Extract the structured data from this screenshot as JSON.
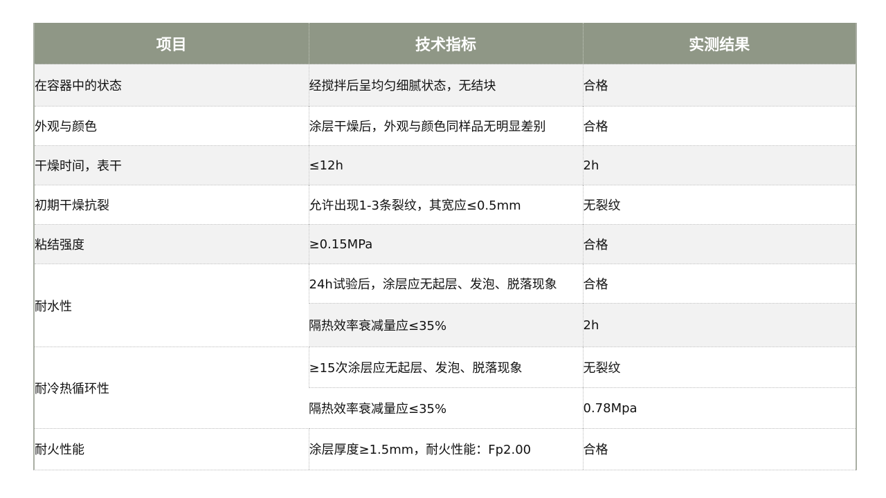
{
  "table": {
    "headers": [
      "项目",
      "技术指标",
      "实测结果"
    ],
    "rows": [
      {
        "item": "在容器中的状态",
        "spec": "经搅拌后呈均匀细腻状态，无结块",
        "result": "合格"
      },
      {
        "item": "外观与颜色",
        "spec": "涂层干燥后，外观与颜色同样品无明显差别",
        "result": "合格"
      },
      {
        "item": "干燥时间，表干",
        "spec": "≤12h",
        "result": "2h"
      },
      {
        "item": "初期干燥抗裂",
        "spec": "允许出现1-3条裂纹，其宽应≤0.5mm",
        "result": "无裂纹"
      },
      {
        "item": "粘结强度",
        "spec": "≥0.15MPa",
        "result": "合格"
      },
      {
        "item": "耐水性",
        "spec": "24h试验后，涂层应无起层、发泡、脱落现象",
        "result": "合格"
      },
      {
        "item": "",
        "spec": "隔热效率衰减量应≤35%",
        "result": "2h"
      },
      {
        "item": "耐冷热循环性",
        "spec": "≥15次涂层应无起层、发泡、脱落现象",
        "result": "无裂纹"
      },
      {
        "item": "",
        "spec": "隔热效率衰减量应≤35%",
        "result": "0.78Mpa"
      },
      {
        "item": "耐火性能",
        "spec": "涂层厚度≥1.5mm，耐火性能：Fp2.00",
        "result": "合格"
      }
    ]
  }
}
